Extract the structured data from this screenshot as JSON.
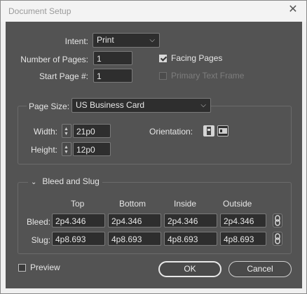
{
  "window": {
    "title": "Document Setup",
    "close_glyph": "✕"
  },
  "intent": {
    "label": "Intent:",
    "value": "Print"
  },
  "pages": {
    "label": "Number of Pages:",
    "value": "1"
  },
  "start_page": {
    "label": "Start Page #:",
    "value": "1"
  },
  "facing_pages": {
    "label": "Facing Pages",
    "checked": true
  },
  "primary_text_frame": {
    "label": "Primary Text Frame",
    "checked": false,
    "disabled": true
  },
  "page_size": {
    "label": "Page Size:",
    "value": "US Business Card",
    "width_label": "Width:",
    "width_value": "21p0",
    "height_label": "Height:",
    "height_value": "12p0",
    "orientation_label": "Orientation:",
    "orientation_icons": [
      "portrait-icon",
      "landscape-icon"
    ]
  },
  "bleed_slug": {
    "section_label": "Bleed and Slug",
    "columns": [
      "Top",
      "Bottom",
      "Inside",
      "Outside"
    ],
    "rows": [
      {
        "label": "Bleed:",
        "values": [
          "2p4.346",
          "2p4.346",
          "2p4.346",
          "2p4.346"
        ]
      },
      {
        "label": "Slug:",
        "values": [
          "4p8.693",
          "4p8.693",
          "4p8.693",
          "4p8.693"
        ]
      }
    ],
    "link_icon": "chain-link-icon"
  },
  "preview": {
    "label": "Preview",
    "checked": false
  },
  "buttons": {
    "ok": "OK",
    "cancel": "Cancel"
  }
}
